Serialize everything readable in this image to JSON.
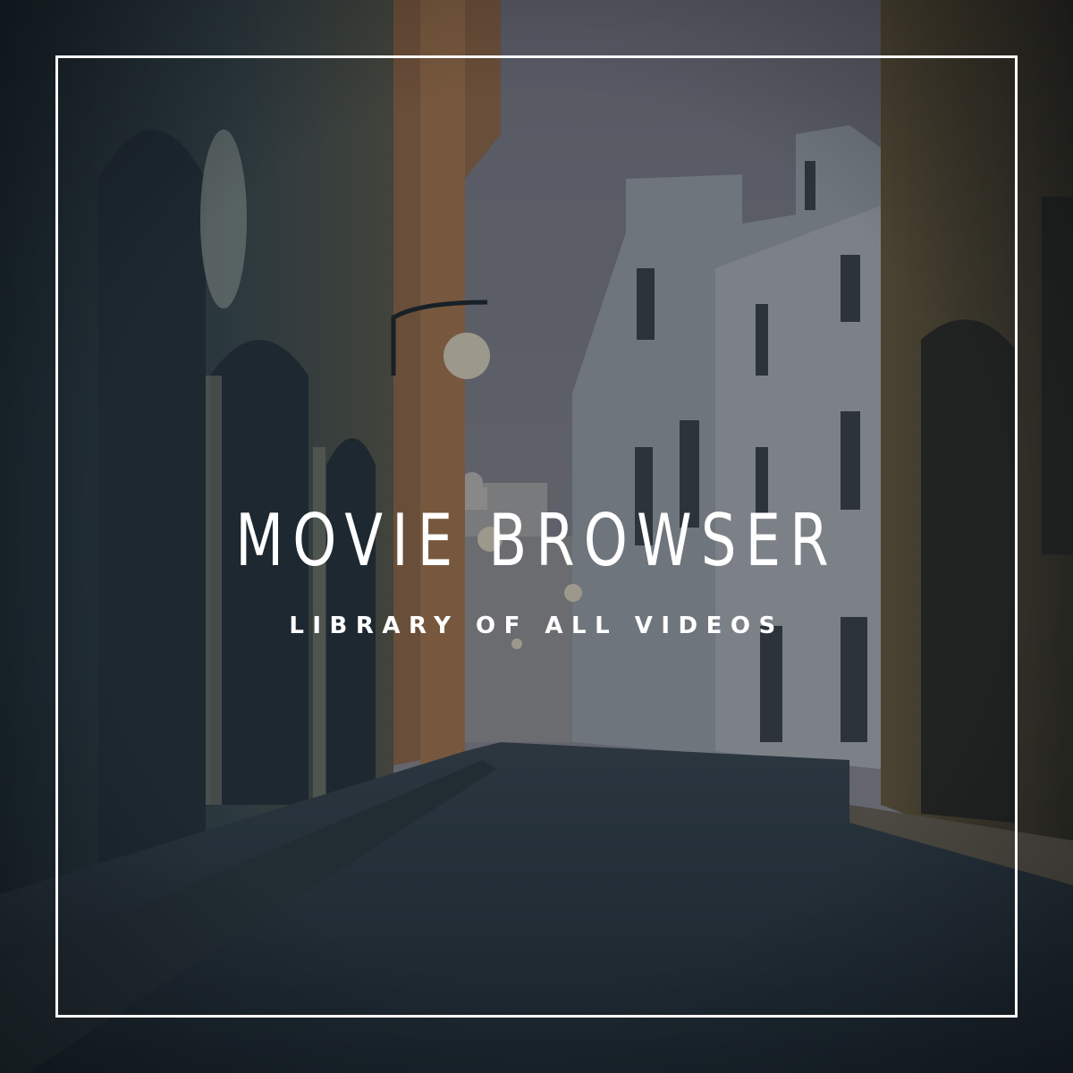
{
  "poster": {
    "title": "MOVIE BROWSER",
    "subtitle": "LIBRARY OF ALL VIDEOS"
  },
  "colors": {
    "text": "#ffffff",
    "frame": "#ffffff",
    "sky": "#8d8a94",
    "shadow": "#1e2832"
  }
}
